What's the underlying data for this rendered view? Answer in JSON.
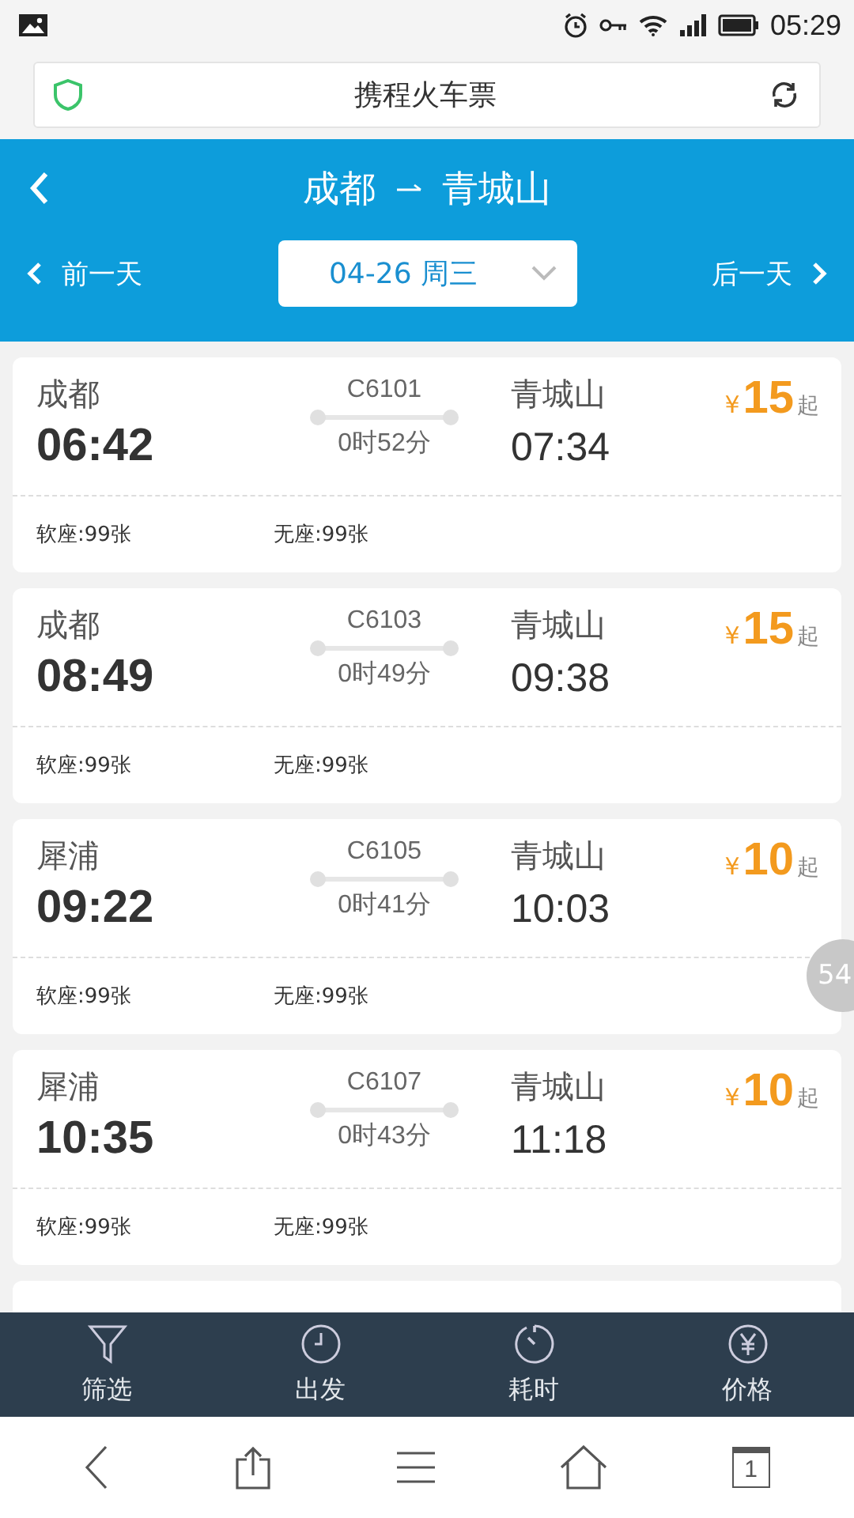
{
  "status_bar": {
    "time": "05:29"
  },
  "address_bar": {
    "title": "携程火车票"
  },
  "header": {
    "from": "成都",
    "to": "青城山",
    "prev_day": "前一天",
    "date": "04-26 周三",
    "next_day": "后一天"
  },
  "trains": [
    {
      "kind": "full",
      "from": "成都",
      "depart": "06:42",
      "code": "C6101",
      "duration": "0时52分",
      "to": "青城山",
      "arrive": "07:34",
      "currency": "¥",
      "price": "15",
      "suffix": "起",
      "seats": [
        "软座:99张",
        "无座:99张"
      ]
    },
    {
      "kind": "full",
      "from": "成都",
      "depart": "08:49",
      "code": "C6103",
      "duration": "0时49分",
      "to": "青城山",
      "arrive": "09:38",
      "currency": "¥",
      "price": "15",
      "suffix": "起",
      "seats": [
        "软座:99张",
        "无座:99张"
      ]
    },
    {
      "kind": "full",
      "from": "犀浦",
      "depart": "09:22",
      "code": "C6105",
      "duration": "0时41分",
      "to": "青城山",
      "arrive": "10:03",
      "currency": "¥",
      "price": "10",
      "suffix": "起",
      "seats": [
        "软座:99张",
        "无座:99张"
      ]
    },
    {
      "kind": "full",
      "from": "犀浦",
      "depart": "10:35",
      "code": "C6107",
      "duration": "0时43分",
      "to": "青城山",
      "arrive": "11:18",
      "currency": "¥",
      "price": "10",
      "suffix": "起",
      "seats": [
        "软座:99张",
        "无座:99张"
      ]
    },
    {
      "kind": "hidden"
    }
  ],
  "scroll_badge": "54",
  "sort_bar": [
    {
      "kind": "filter",
      "label": "筛选"
    },
    {
      "kind": "depart",
      "label": "出发"
    },
    {
      "kind": "duration",
      "label": "耗时"
    },
    {
      "kind": "price",
      "label": "价格"
    }
  ],
  "browser_nav": {
    "tab_count": "1"
  }
}
